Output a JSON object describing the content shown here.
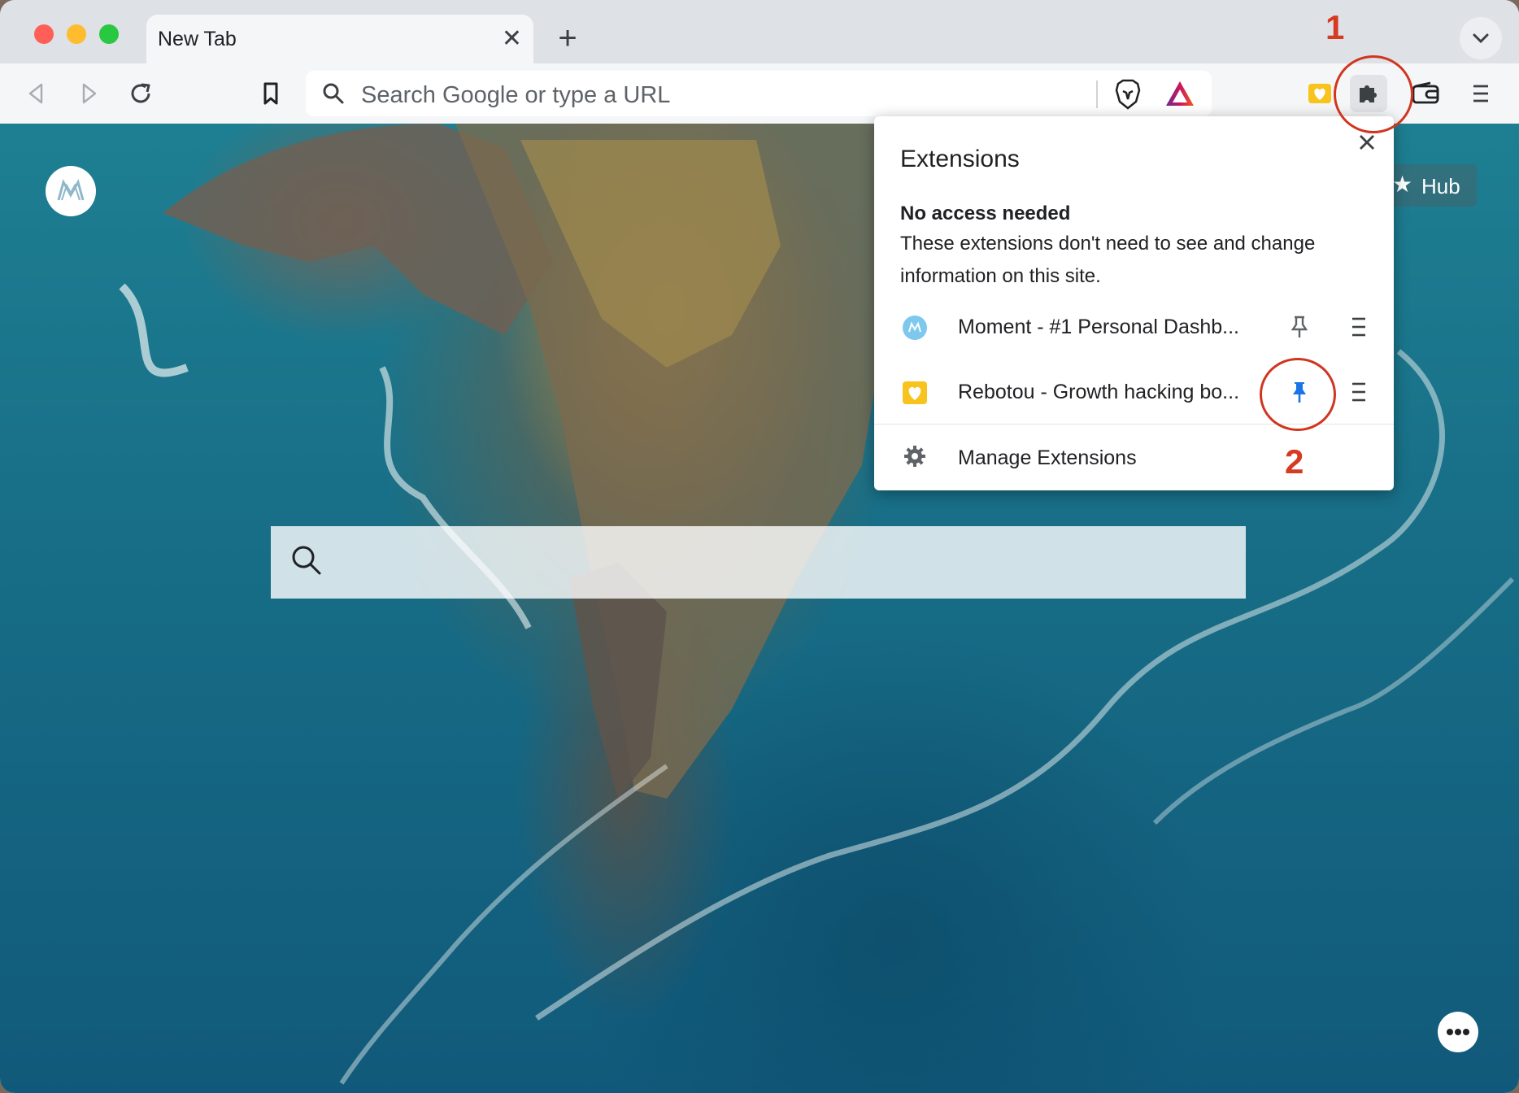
{
  "tab": {
    "title": "New Tab",
    "close_glyph": "✕"
  },
  "toolbar": {
    "new_tab_glyph": "+",
    "omnibox_placeholder": "Search Google or type a URL",
    "icons": [
      "back-icon",
      "forward-icon",
      "reload-icon",
      "bookmark-icon",
      "search-icon",
      "brave-shields-icon",
      "brave-rewards-icon",
      "rebotou-extension-icon",
      "extensions-puzzle-icon",
      "wallet-icon",
      "menu-icon"
    ]
  },
  "page": {
    "hub_label": "Hub",
    "hub_star": "★",
    "background": "aerial coastal cliffs"
  },
  "extensions_popup": {
    "title": "Extensions",
    "section_title": "No access needed",
    "section_desc": "These extensions don't need to see and change information on this site.",
    "items": [
      {
        "name": "Moment - #1 Personal Dashb...",
        "pinned": false,
        "icon": "moment-icon"
      },
      {
        "name": "Rebotou - Growth hacking bo...",
        "pinned": true,
        "icon": "rebotou-icon"
      }
    ],
    "manage_label": "Manage Extensions"
  },
  "annotations": {
    "step1": "1",
    "step2": "2",
    "color": "#d0361f"
  },
  "colors": {
    "pin_active": "#1a73e8",
    "pin_inactive": "#5f6368",
    "tabstrip": "#dee1e6",
    "toolbar": "#f5f6f7"
  }
}
